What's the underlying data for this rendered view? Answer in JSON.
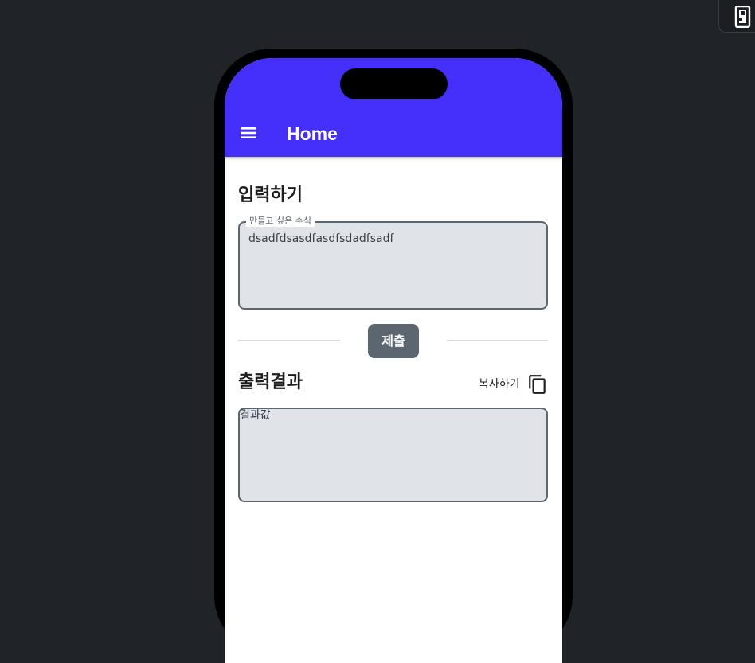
{
  "app": {
    "title": "Home"
  },
  "input_section": {
    "heading": "입력하기",
    "field_label": "만들고 싶은 수식",
    "field_value": "dsadfdsasdfasdfsdadfsadf"
  },
  "submit": {
    "label": "제출"
  },
  "output_section": {
    "heading": "출력결과",
    "copy_label": "복사하기",
    "result_value": "결과값"
  },
  "icons": {
    "menu": "hamburger-menu-icon",
    "copy": "copy-icon",
    "device": "phone-device-icon"
  },
  "colors": {
    "appbar": "#4530fb",
    "button": "#5b6670",
    "field_bg": "#e0e3e8",
    "page_bg": "#202328"
  }
}
